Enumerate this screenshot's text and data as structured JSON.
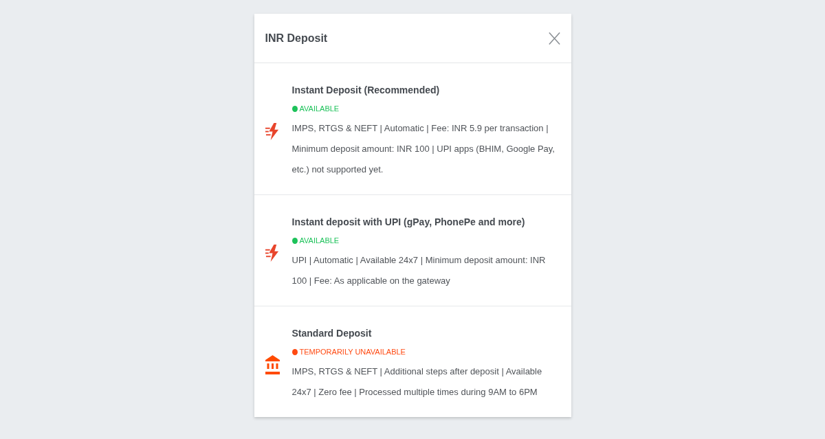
{
  "dialog": {
    "title": "INR Deposit"
  },
  "options": [
    {
      "kind": "instant",
      "title": "Instant Deposit (Recommended)",
      "status": {
        "label": "AVAILABLE",
        "available": true
      },
      "description": "IMPS, RTGS & NEFT | Automatic | Fee: INR 5.9 per transaction | Minimum deposit amount: INR 100 | UPI apps (BHIM, Google Pay, etc.) not supported yet."
    },
    {
      "kind": "instant",
      "title": "Instant deposit with UPI (gPay, PhonePe and more)",
      "status": {
        "label": "AVAILABLE",
        "available": true
      },
      "description": "UPI | Automatic | Available 24x7 | Minimum deposit amount: INR 100 | Fee: As applicable on the gateway"
    },
    {
      "kind": "bank",
      "title": "Standard Deposit",
      "status": {
        "label": "TEMPORARILY UNAVAILABLE",
        "available": false
      },
      "description": "IMPS, RTGS & NEFT | Additional steps after deposit | Available 24x7 | Zero fee | Processed multiple times during 9AM to 6PM"
    }
  ]
}
